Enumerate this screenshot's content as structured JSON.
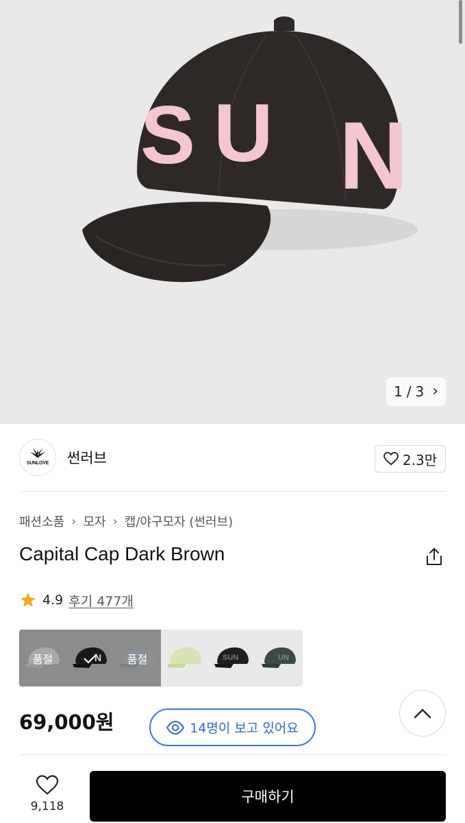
{
  "hero": {
    "pager_current": "1",
    "pager_sep": "/",
    "pager_total": "3",
    "cap_letters": [
      "S",
      "U",
      "N"
    ],
    "cap_color": "#2e2926",
    "letter_color": "#f2c7cf"
  },
  "brand": {
    "name": "썬러브",
    "logo_text": "SUNLOVE",
    "likes": "2.3만"
  },
  "breadcrumb": [
    "패션소품",
    "모자",
    "캡/야구모자 (썬러브)"
  ],
  "product": {
    "title": "Capital Cap Dark Brown",
    "rating": "4.9",
    "reviews": "후기 477개",
    "price": "69,000원",
    "viewers": "14명이 보고 있어요"
  },
  "variants": [
    {
      "badge": "품절",
      "color": "#a9a9a9",
      "letters": "",
      "soldout": true
    },
    {
      "badge": "",
      "color": "#1a1a1a",
      "letters": "SU",
      "soldout": true,
      "selected": true
    },
    {
      "badge": "품절",
      "color": "#8b9096",
      "letters": "",
      "soldout": true
    },
    {
      "badge": "",
      "color": "#d7e3b2",
      "letters": "",
      "soldout": false
    },
    {
      "badge": "",
      "color": "#1f1f1f",
      "letters": "SUN",
      "soldout": false
    },
    {
      "badge": "",
      "color": "#3b4a44",
      "letters": "UN",
      "soldout": false
    }
  ],
  "bottom_bar": {
    "wish_count": "9,118",
    "buy_label": "구매하기"
  },
  "colors": {
    "accent_blue": "#2f66d4",
    "star": "#f5a623",
    "buy_bg": "#000000"
  }
}
